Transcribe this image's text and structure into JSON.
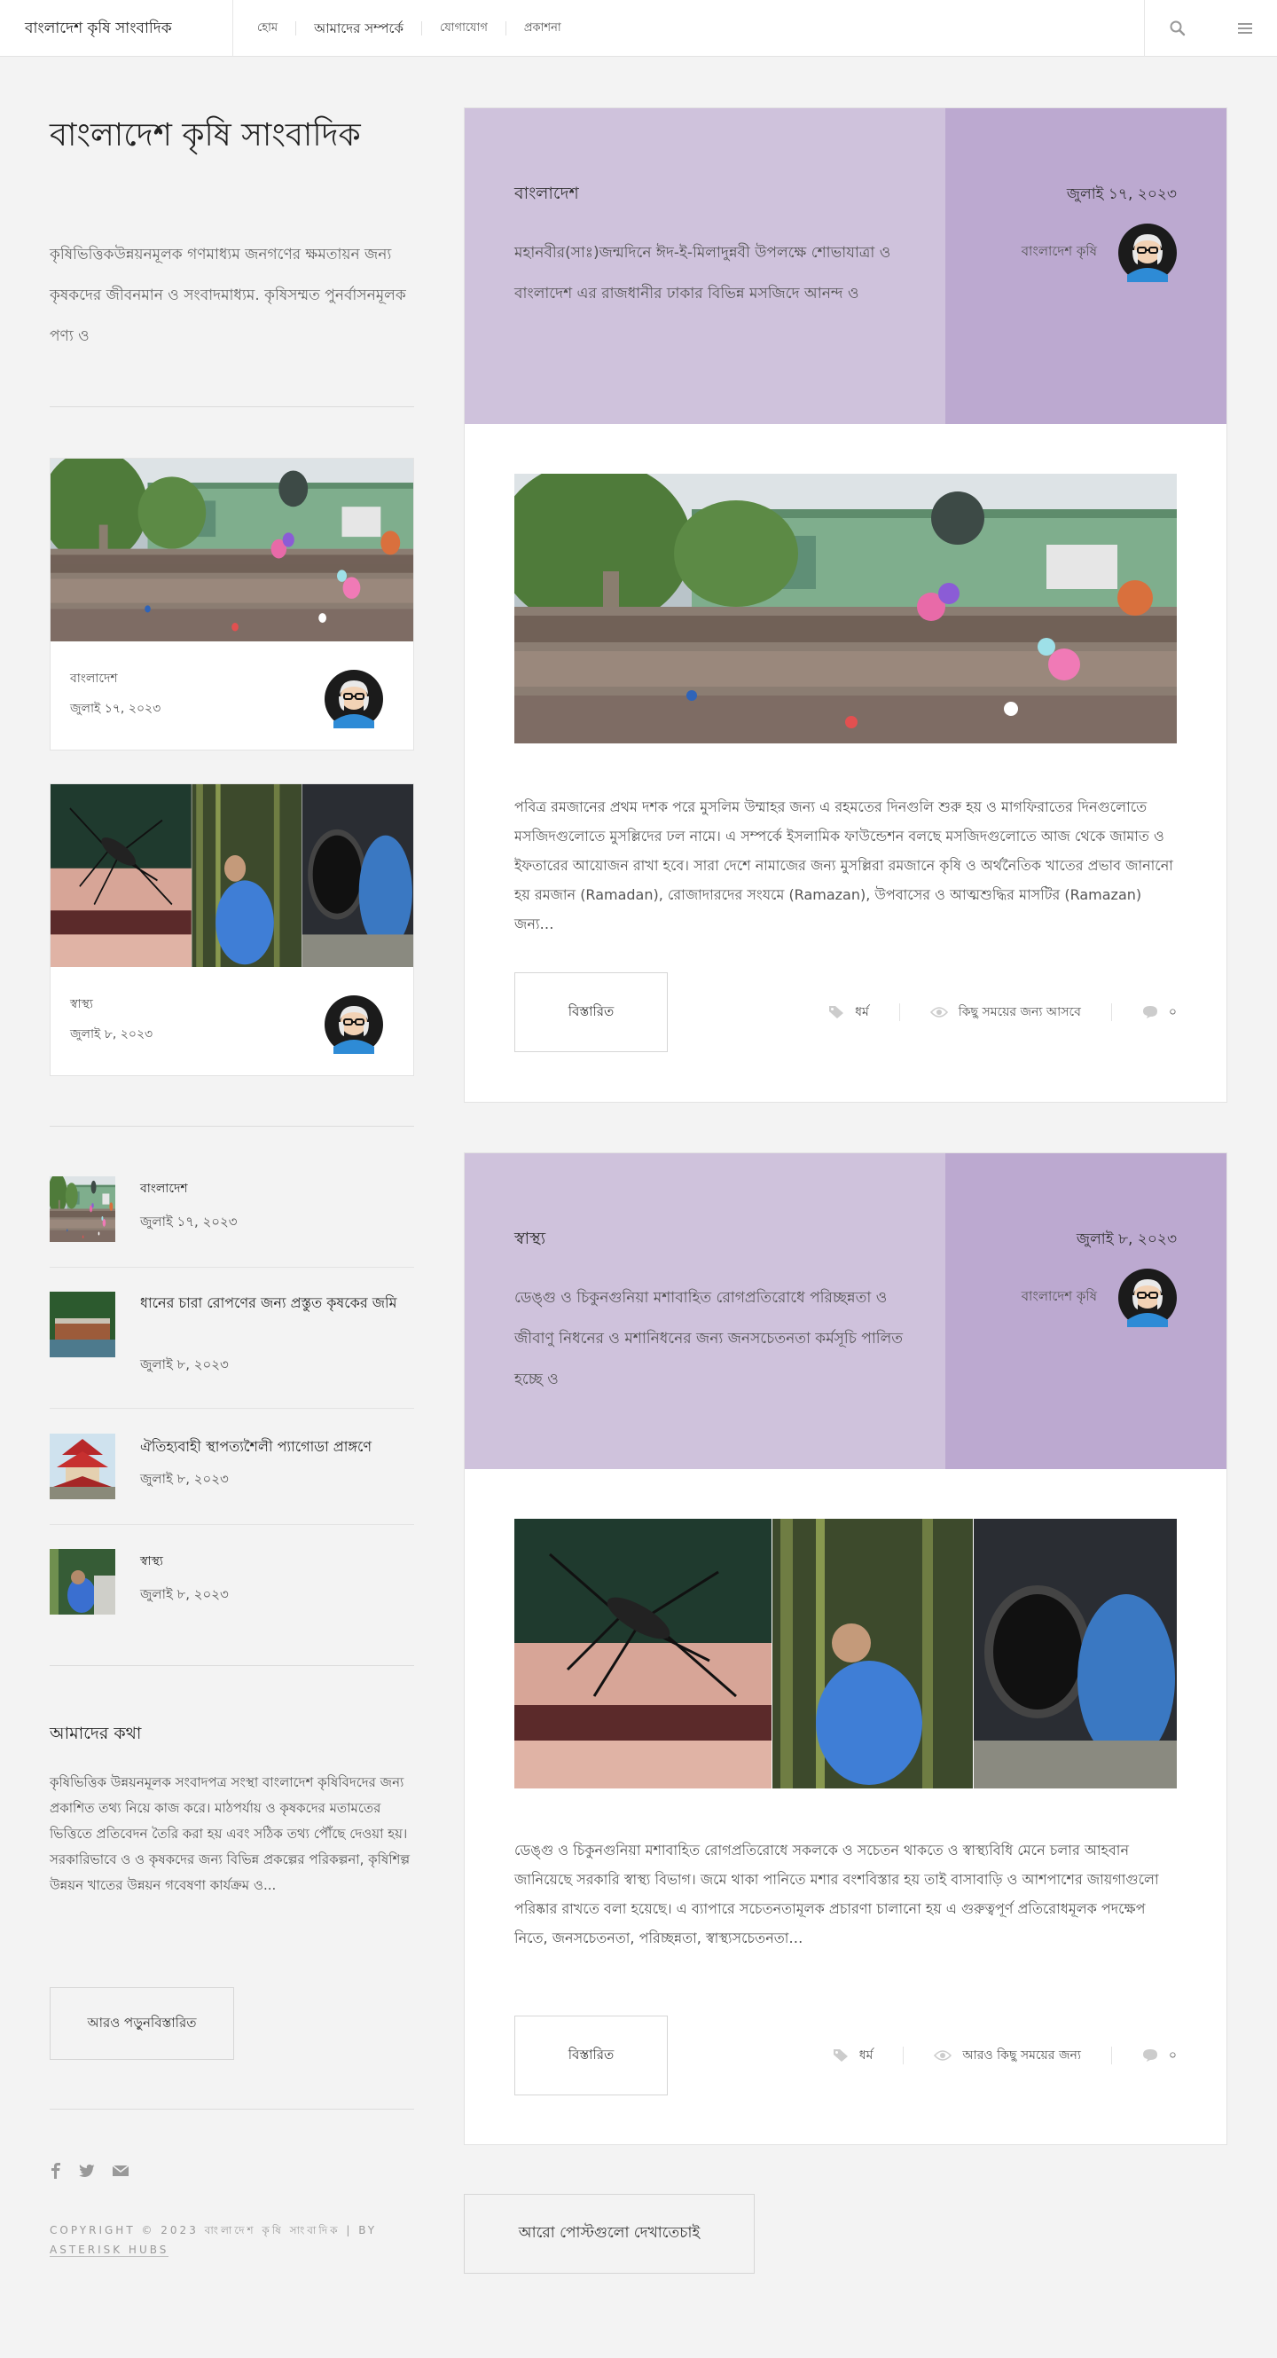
{
  "header": {
    "brand": "বাংলাদেশ কৃষি সাংবাদিক",
    "nav": [
      "হোম",
      "আমাদের সম্পর্কে",
      "যোগাযোগ",
      "প্রকাশনা"
    ]
  },
  "sidebar": {
    "site_title": "বাংলাদেশ কৃষি সাংবাদিক",
    "site_desc": "কৃষিভিত্তিকউন্নয়নমূলক গণমাধ্যম জনগণের ক্ষমতায়ন জন্য কৃষকদের জীবনমান ও সংবাদমাধ্যম. কৃষিসম্মত পুনর্বাসনমূলক পণ্য ও",
    "featured_cards": [
      {
        "category": "বাংলাদেশ",
        "date": "জুলাই ১৭, ২০২৩"
      },
      {
        "category": "স্বাস্থ্য",
        "date": "জুলাই ৮, ২০২৩"
      }
    ],
    "recent": [
      {
        "title": "বাংলাদেশ",
        "date": "জুলাই ১৭, ২০২৩"
      },
      {
        "title": "ধানের চারা রোপণের জন্য প্রস্তুত কৃষকের জমি",
        "date": "জুলাই ৮, ২০২৩"
      },
      {
        "title": "ঐতিহ্যবাহী স্থাপত্যশৈলী প্যাগোডা প্রাঙ্গণে",
        "date": "জুলাই ৮, ২০২৩"
      },
      {
        "title": "স্বাস্থ্য",
        "date": "জুলাই ৮, ২০২৩"
      }
    ],
    "about_title": "আমাদের কথা",
    "about_text": "কৃষিভিত্তিক উন্নয়নমূলক সংবাদপত্র সংস্থা বাংলাদেশ কৃষিবিদদের জন্য প্রকাশিত তথ্য নিয়ে কাজ করে। মাঠপর্যায় ও কৃষকদের মতামতের ভিত্তিতে প্রতিবেদন তৈরি করা হয় এবং সঠিক তথ্য পৌঁছে দেওয়া হয়। সরকারিভাবে ও ও কৃষকদের জন্য বিভিন্ন প্রকল্পের পরিকল্পনা, কৃষিশিল্প উন্নয়ন খাতের উন্নয়ন গবেষণা কার্যক্রম ও...",
    "about_button": "আরও পড়ুনবিস্তারিত",
    "copyright_text": "COPYRIGHT © 2023 বাংলাদেশ কৃষি সাংবাদিক | BY",
    "copyright_link": "ASTERISK HUBS"
  },
  "posts": [
    {
      "category": "বাংলাদেশ",
      "excerpt": "মহানবীর(সাঃ)জন্মদিনে ঈদ‑ই‑মিলাদুন্নবী উপলক্ষে শোভাযাত্রা ও বাংলাদেশ এর রাজধানীর ঢাকার বিভিন্ন মসজিদে আনন্দ ও",
      "date": "জুলাই ১৭, ২০২৩",
      "author": "বাংলাদেশ কৃষি",
      "body": "পবিত্র রমজানের প্রথম দশক পরে মুসলিম উম্মাহর জন্য এ রহমতের দিনগুলি শুরু হয় ও মাগফিরাতের দিনগুলোতে মসজিদগুলোতে মুসল্লিদের ঢল নামে। এ সম্পর্কে ইসলামিক ফাউন্ডেশন বলছে মসজিদগুলোতে আজ থেকে জামাত ও ইফতারের আয়োজন রাখা হবে। সারা দেশে নামাজের জন্য মুসল্লিরা রমজানে কৃষি ও অর্থনৈতিক খাতের প্রভাব জানানো হয় রমজান (Ramadan), রোজাদারদের সংযমে (Ramazan), উপবাসের ও আত্মশুদ্ধির মাসটির (Ramazan) জন্য…",
      "read_more": "বিস্তারিত",
      "tag": "ধর্ম",
      "views": "কিছু সময়ের জন্য আসবে",
      "comments": "০"
    },
    {
      "category": "স্বাস্থ্য",
      "excerpt": "ডেঙ্গু ও চিকুনগুনিয়া মশাবাহিত রোগপ্রতিরোধে পরিচ্ছন্নতা ও জীবাণু নিধনের ও মশানিধনের জন্য জনসচেতনতা কর্মসূচি পালিত হচ্ছে ও",
      "date": "জুলাই ৮, ২০২৩",
      "author": "বাংলাদেশ কৃষি",
      "body": "ডেঙ্গু ও চিকুনগুনিয়া মশাবাহিত রোগপ্রতিরোধে সকলকে ও সচেতন থাকতে ও স্বাস্থ্যবিধি মেনে চলার আহবান জানিয়েছে সরকারি স্বাস্থ্য বিভাগ। জমে থাকা পানিতে মশার বংশবিস্তার হয় তাই বাসাবাড়ি ও আশপাশের জায়গাগুলো পরিষ্কার রাখতে বলা হয়েছে। এ ব্যাপারে সচেতনতামূলক প্রচারণা চালানো হয় এ গুরুত্বপূর্ণ প্রতিরোধমূলক পদক্ষেপ নিতে, জনসচেতনতা, পরিচ্ছন্নতা, স্বাস্থ্যসচেতনতা…",
      "read_more": "বিস্তারিত",
      "tag": "ধর্ম",
      "views": "আরও কিছু সময়ের জন্য",
      "comments": "০"
    }
  ],
  "load_more": "আরো পোস্টগুলো দেখাতেচাই",
  "colors": {
    "band_left": "#cfc2dc",
    "band_right": "#bca9d0",
    "background": "#f3f3f3"
  }
}
